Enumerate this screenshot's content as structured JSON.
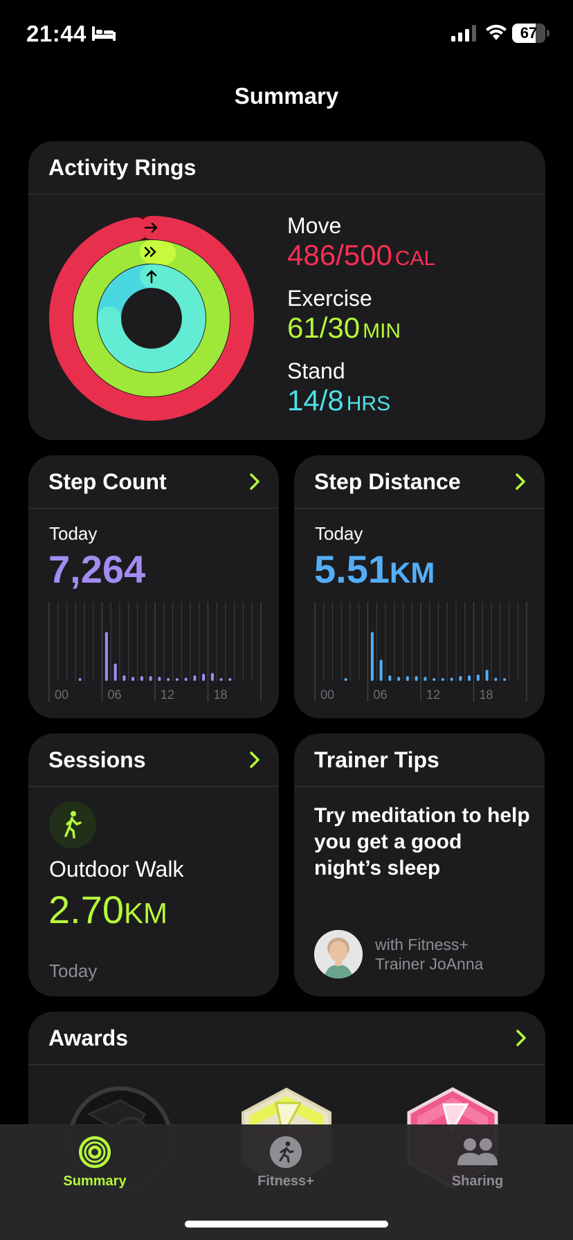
{
  "status_bar": {
    "time": "21:44",
    "battery": "67",
    "icons": [
      "bed-icon",
      "signal-icon",
      "wifi-icon",
      "battery-icon"
    ]
  },
  "page_title": "Summary",
  "activity_rings": {
    "title": "Activity Rings",
    "move": {
      "label": "Move",
      "value": "486/500",
      "unit": "CAL",
      "progress": 0.972,
      "color": "#ff2d55"
    },
    "exercise": {
      "label": "Exercise",
      "value": "61/30",
      "unit": "MIN",
      "progress": 2.03,
      "color": "#b6f83b"
    },
    "stand": {
      "label": "Stand",
      "value": "14/8",
      "unit": "HRS",
      "progress": 1.75,
      "color": "#4de1e6"
    }
  },
  "step_count": {
    "title": "Step Count",
    "period": "Today",
    "value": "7,264",
    "color": "#a28cf0"
  },
  "step_distance": {
    "title": "Step Distance",
    "period": "Today",
    "value": "5.51",
    "unit": "KM",
    "color": "#53aef7"
  },
  "chart_data": [
    {
      "type": "bar",
      "x_tick_labels": [
        "00",
        "06",
        "12",
        "18"
      ],
      "x": [
        0,
        1,
        2,
        3,
        4,
        5,
        6,
        7,
        8,
        9,
        10,
        11,
        12,
        13,
        14,
        15,
        16,
        17,
        18,
        19,
        20,
        21,
        22,
        23
      ],
      "values": [
        0,
        0,
        0,
        0.02,
        0,
        0,
        0.62,
        0.22,
        0.07,
        0.05,
        0.06,
        0.06,
        0.05,
        0.03,
        0.03,
        0.04,
        0.07,
        0.09,
        0.1,
        0.03,
        0.02,
        0,
        0,
        0
      ],
      "color": "#a28cf0"
    },
    {
      "type": "bar",
      "x_tick_labels": [
        "00",
        "06",
        "12",
        "18"
      ],
      "x": [
        0,
        1,
        2,
        3,
        4,
        5,
        6,
        7,
        8,
        9,
        10,
        11,
        12,
        13,
        14,
        15,
        16,
        17,
        18,
        19,
        20,
        21,
        22,
        23
      ],
      "values": [
        0,
        0,
        0,
        0.02,
        0,
        0,
        0.62,
        0.27,
        0.07,
        0.05,
        0.06,
        0.06,
        0.05,
        0.03,
        0.03,
        0.04,
        0.06,
        0.07,
        0.08,
        0.14,
        0.04,
        0.02,
        0,
        0
      ],
      "color": "#53aef7"
    }
  ],
  "sessions": {
    "title": "Sessions",
    "activity": "Outdoor Walk",
    "value": "2.70",
    "unit": "KM",
    "date": "Today"
  },
  "trainer_tips": {
    "title": "Trainer Tips",
    "tip": "Try meditation to help you get a good night’s sleep",
    "trainer_line1": "with Fitness+",
    "trainer_line2": "Trainer JoAnna"
  },
  "awards": {
    "title": "Awards"
  },
  "tab_bar": {
    "tabs": [
      {
        "label": "Summary",
        "active": true
      },
      {
        "label": "Fitness+",
        "active": false
      },
      {
        "label": "Sharing",
        "active": false
      }
    ]
  }
}
